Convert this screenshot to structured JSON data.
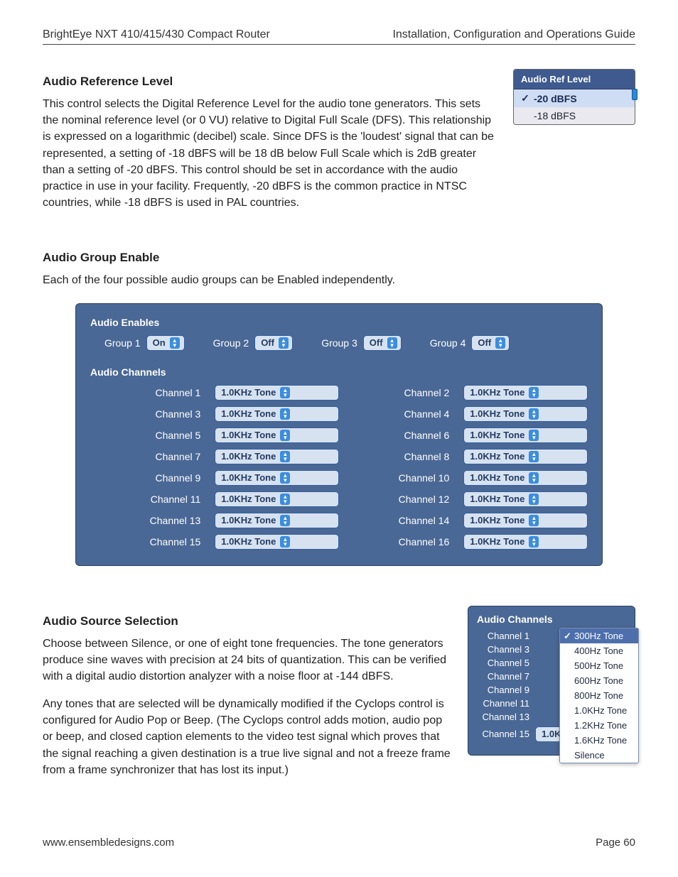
{
  "header": {
    "left": "BrightEye NXT 410/415/430 Compact Router",
    "right": "Installation, Configuration and Operations Guide"
  },
  "sections": {
    "ref": {
      "heading": "Audio Reference Level",
      "para": "This control selects the Digital Reference Level for the audio tone generators. This sets the nominal reference level (or 0 VU) relative to Digital Full Scale (DFS). This relationship is expressed on a logarithmic (decibel) scale. Since DFS is the 'loudest' signal that can be represented, a setting of -18 dBFS will be 18 dB below Full Scale which is 2dB greater than a setting of -20 dBFS. This control should be set in accordance with the audio practice in use in your facility. Frequently, -20 dBFS is the common practice in NTSC countries, while -18 dBFS is used in PAL countries."
    },
    "group": {
      "heading": "Audio Group Enable",
      "para": "Each of the four possible audio groups can be Enabled independently."
    },
    "source": {
      "heading": "Audio Source Selection",
      "para1": "Choose between Silence, or one of eight tone frequencies. The tone generators produce sine waves with precision at 24 bits of quantization. This can be verified with a digital audio distortion analyzer with a noise floor at -144 dBFS.",
      "para2": "Any tones that are selected will be dynamically modified if the Cyclops control is configured for Audio Pop or Beep. (The Cyclops control adds motion, audio pop or beep, and closed caption elements to the video test signal which proves that the signal reaching a given destination is a true live signal and not a freeze frame from a frame synchronizer that has lost its input.)"
    }
  },
  "reflevel_widget": {
    "title": "Audio Ref Level",
    "options": [
      "-20 dBFS",
      "-18 dBFS"
    ],
    "selected_index": 0
  },
  "audio_panel": {
    "enables_header": "Audio Enables",
    "groups": [
      {
        "label": "Group 1",
        "value": "On"
      },
      {
        "label": "Group 2",
        "value": "Off"
      },
      {
        "label": "Group 3",
        "value": "Off"
      },
      {
        "label": "Group 4",
        "value": "Off"
      }
    ],
    "channels_header": "Audio Channels",
    "tone_value": "1.0KHz Tone",
    "channels": [
      "Channel 1",
      "Channel 2",
      "Channel 3",
      "Channel 4",
      "Channel 5",
      "Channel 6",
      "Channel 7",
      "Channel 8",
      "Channel 9",
      "Channel 10",
      "Channel 11",
      "Channel 12",
      "Channel 13",
      "Channel 14",
      "Channel 15",
      "Channel 16"
    ]
  },
  "ac_side_panel": {
    "header": "Audio Channels",
    "visible_channels": [
      "Channel 1",
      "Channel 3",
      "Channel 5",
      "Channel 7",
      "Channel 9",
      "Channel 11",
      "Channel 13"
    ],
    "last_channel": "Channel 15",
    "last_value": "1.0KHz Tone",
    "menu_items": [
      "300Hz Tone",
      "400Hz Tone",
      "500Hz Tone",
      "600Hz Tone",
      "800Hz Tone",
      "1.0KHz Tone",
      "1.2KHz Tone",
      "1.6KHz Tone",
      "Silence"
    ],
    "menu_selected_index": 0
  },
  "footer": {
    "left": "www.ensembledesigns.com",
    "right": "Page 60"
  }
}
